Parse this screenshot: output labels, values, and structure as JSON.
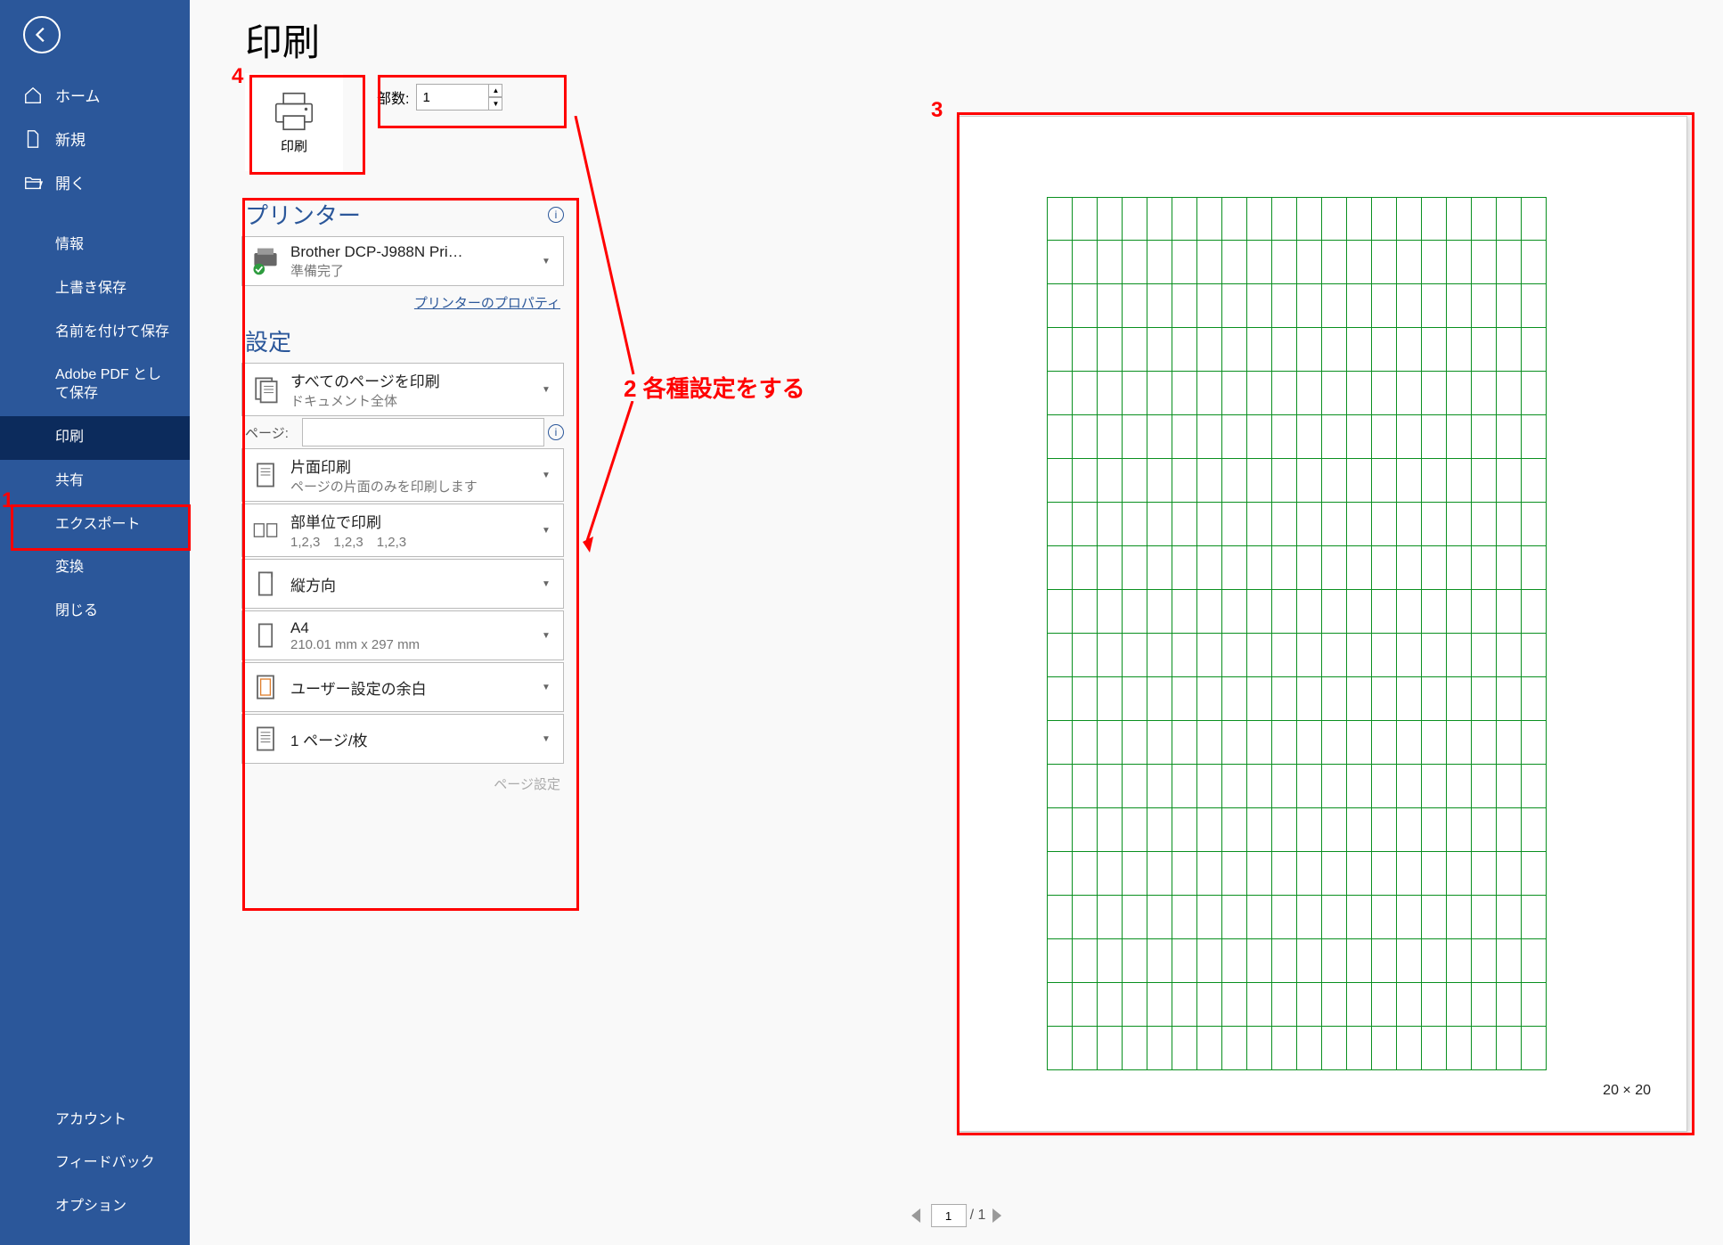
{
  "title": "印刷",
  "sidebar": {
    "back": "back",
    "top": [
      {
        "label": "ホーム",
        "icon": "home"
      },
      {
        "label": "新規",
        "icon": "file"
      },
      {
        "label": "開く",
        "icon": "folder"
      }
    ],
    "mid": [
      {
        "label": "情報"
      },
      {
        "label": "上書き保存"
      },
      {
        "label": "名前を付けて保存"
      },
      {
        "label": "Adobe PDF として保存"
      },
      {
        "label": "印刷",
        "selected": true
      },
      {
        "label": "共有"
      },
      {
        "label": "エクスポート"
      },
      {
        "label": "変換"
      },
      {
        "label": "閉じる"
      }
    ],
    "bottom": [
      {
        "label": "アカウント"
      },
      {
        "label": "フィードバック"
      },
      {
        "label": "オプション"
      }
    ]
  },
  "print_button": "印刷",
  "copies": {
    "label": "部数:",
    "value": "1"
  },
  "printer": {
    "heading": "プリンター",
    "name": "Brother DCP-J988N Pri…",
    "status": "準備完了",
    "props_link": "プリンターのプロパティ"
  },
  "settings": {
    "heading": "設定",
    "items": [
      {
        "l1": "すべてのページを印刷",
        "l2": "ドキュメント全体",
        "icon": "pages"
      },
      {
        "l1": "片面印刷",
        "l2": "ページの片面のみを印刷します",
        "icon": "single"
      },
      {
        "l1": "部単位で印刷",
        "l2": "1,2,3　1,2,3　1,2,3",
        "icon": "collate"
      },
      {
        "l1": "縦方向",
        "l2": "",
        "icon": "portrait"
      },
      {
        "l1": "A4",
        "l2": "210.01 mm x 297 mm",
        "icon": "size"
      },
      {
        "l1": "ユーザー設定の余白",
        "l2": "",
        "icon": "margins"
      },
      {
        "l1": "1 ページ/枚",
        "l2": "",
        "icon": "persheet"
      }
    ],
    "pages_label": "ページ:",
    "pages_value": "",
    "page_setup": "ページ設定"
  },
  "annotations": {
    "n1": "1",
    "n2": "2 各種設定をする",
    "n3": "3",
    "n4": "4"
  },
  "preview": {
    "dim": "20 × 20",
    "rows": 20,
    "cols": 20
  },
  "pager": {
    "current": "1",
    "total": "/ 1"
  }
}
